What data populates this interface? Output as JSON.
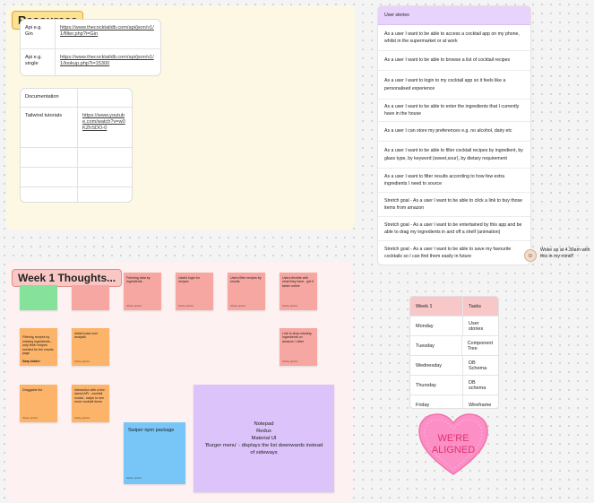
{
  "resources": {
    "title": "Resources",
    "api_table": [
      {
        "label": "Api e.g. Gin",
        "link": "https://www.thecocktaildb.com/api/json/v1/1/filter.php?i=Gin"
      },
      {
        "label": "Api e.g. single",
        "link": "https://www.thecocktaildb.com/api/json/v1/1/lookup.php?i=15300"
      }
    ],
    "docs_table": {
      "header": "Documentation",
      "tailwind_label": "Tailwind tutorials",
      "tailwind_link": "https://www.youtube.com/watch?v=w0KZhSDO-0"
    }
  },
  "user_stories": {
    "header": "User stories",
    "items": [
      "As a user I want to be able to access a cocktail app on my phone, whilst in the supermarket or at work",
      "As a user I want to be able to browse a list of cocktail recipes",
      "As a user I want to login to my cocktail app so it feels like a personalised experience",
      "As a user I want to be able to enter the ingredients that I currently have in the house",
      "As a user I can store my preferences e.g. no alcohol, dairy etc",
      "As a user I want to be able to filter cocktail recipes by ingredient, by glass type, by keyword (sweet,sour), by dietary requirement",
      "As a user I want to filter results according to how few extra ingredients I need to source",
      "Stretch goal - As a user I want to be able to click a link to buy those items from amazon",
      "Stretch goal - As a user I want to be entertained by this app and be able to drag my ingredients in and off a shelf (animation)",
      "Stretch goal - As a user I want to be able to save my favourite cocktails so I can find them easily in future"
    ]
  },
  "comment": {
    "text": "Woke up at 4.30am with this in my mind!!"
  },
  "week1": {
    "title": "Week 1 Thoughts...",
    "stickies": [
      {
        "text": "",
        "author": ""
      },
      {
        "text": "",
        "author": ""
      },
      {
        "text": "Fetching data by ingredients",
        "author": "Sticky author"
      },
      {
        "text": "Useful login for recipes",
        "author": "Sticky author"
      },
      {
        "text": "Users filter recipes by results",
        "author": "Sticky author"
      },
      {
        "text": "Users flexible with what they have - get it faster online",
        "author": "Sticky author"
      },
      {
        "text": "Filtering recipes by missing ingredients - only fetch recipes needed for the results page\n\nKeep hidden",
        "author": "Sticky author"
      },
      {
        "text": "Added past user analysis",
        "author": "Sticky author"
      },
      {
        "text": "Link to shop missing ingredients on amazon / other",
        "author": "Sticky author"
      },
      {
        "text": "Draggable list",
        "author": "Sticky author"
      },
      {
        "text": "Interaction with a few saved API - cocktail modal - swipe to see more cocktail items",
        "author": "Sticky author"
      },
      {
        "text": "Swiper npm package",
        "author": "Sticky author"
      }
    ],
    "notes_lines": [
      "Notepad",
      "Redux",
      "Material UI",
      "'Burger menu' - displays the list downwards instead of sideways"
    ]
  },
  "schedule": {
    "headers": [
      "Week 1",
      "Tasks"
    ],
    "rows": [
      [
        "Monday",
        "User stories"
      ],
      [
        "Tuesday",
        "Component Tree"
      ],
      [
        "Wednesday",
        "DB Schema"
      ],
      [
        "Thursday",
        "DB schema"
      ],
      [
        "Friday",
        "Wireframe"
      ]
    ]
  },
  "heart": {
    "line1": "WE'RE",
    "line2": "ALIGNED"
  },
  "colors": {
    "resources_bg": "#fdf8e4",
    "week_bg": "#fdf1f1",
    "title_yellow": "#fbe190",
    "title_pink": "#f9c7c4",
    "user_stories_header": "#e7d3fb",
    "schedule_header": "#f8c8c8",
    "sticky_green": "#86e19a",
    "sticky_red": "#f7a7a1",
    "sticky_orange": "#fcb36a",
    "sticky_blue": "#78c6f7",
    "sticky_purple": "#dcc3fa",
    "heart_pink": "#fb8fc6",
    "heart_text": "#e0336e"
  }
}
